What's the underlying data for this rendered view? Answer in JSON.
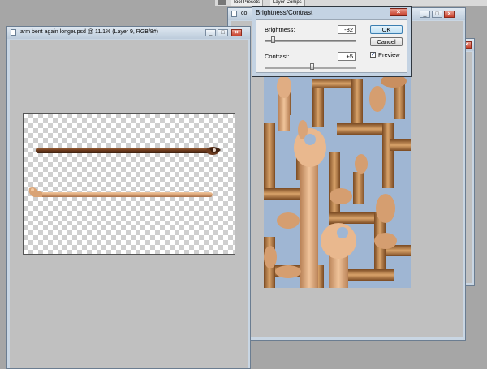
{
  "palette": {
    "tabs": [
      "Tool Presets",
      "Layer Comps"
    ]
  },
  "back_window": {
    "title_fragment": "co"
  },
  "main_window": {
    "title": "arm bent again longer.psd @ 11.1% (Layer 9, RGB/8#)"
  },
  "dialog": {
    "title": "Brightness/Contrast",
    "brightness_label": "Brightness:",
    "brightness_value": "-82",
    "contrast_label": "Contrast:",
    "contrast_value": "+5",
    "ok_label": "OK",
    "cancel_label": "Cancel",
    "preview_label": "Preview",
    "preview_checked": true,
    "brightness_slider_fraction": 0.09,
    "contrast_slider_fraction": 0.52
  },
  "window_buttons": {
    "minimize": "_",
    "maximize": "□",
    "close": "×"
  },
  "colors": {
    "window_frame": "#c9d6e3",
    "close_button": "#c8412c",
    "workspace": "#a6a6a6",
    "arm_dark": "#6b3a1e",
    "arm_light": "#d9a375",
    "sky": "#9fb6d3",
    "wood": "#b07a45"
  }
}
